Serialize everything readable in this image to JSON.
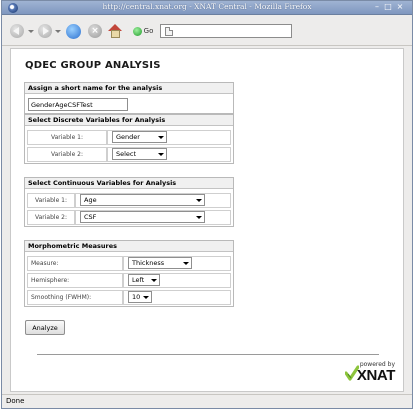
{
  "window": {
    "title": "http://central.xnat.org - XNAT Central - Mozilla Firefox"
  },
  "toolbar": {
    "go_label": "Go",
    "url": ""
  },
  "page": {
    "title": "QDEC GROUP ANALYSIS",
    "short_name": {
      "header": "Assign a short name for the analysis",
      "value": "GenderAgeCSFTest"
    },
    "discrete": {
      "header": "Select Discrete Variables for Analysis",
      "rows": [
        {
          "label": "Variable 1:",
          "value": "Gender"
        },
        {
          "label": "Variable 2:",
          "value": "Select"
        }
      ]
    },
    "continuous": {
      "header": "Select Continuous Variables for Analysis",
      "rows": [
        {
          "label": "Variable 1:",
          "value": "Age"
        },
        {
          "label": "Variable 2:",
          "value": "CSF"
        }
      ]
    },
    "morph": {
      "header": "Morphometric Measures",
      "rows": [
        {
          "label": "Measure:",
          "value": "Thickness"
        },
        {
          "label": "Hemisphere:",
          "value": "Left"
        },
        {
          "label": "Smoothing (FWHM):",
          "value": "10"
        }
      ]
    },
    "analyze_label": "Analyze",
    "logo": {
      "powered_by": "powered by",
      "name": "XNAT"
    }
  },
  "status": {
    "text": "Done"
  }
}
